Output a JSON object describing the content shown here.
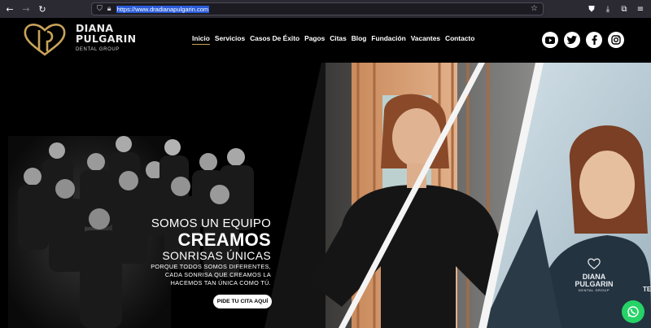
{
  "browser": {
    "url": "https://www.dradianapulgarin.com",
    "icons": [
      "back-arrow-icon",
      "forward-arrow-icon",
      "reload-icon",
      "shield-icon",
      "lock-icon",
      "star-icon",
      "pocket-icon",
      "download-icon",
      "extensions-icon",
      "menu-icon"
    ]
  },
  "brand": {
    "name_line1": "DIANA",
    "name_line2": "PULGARIN",
    "subtitle": "DENTAL GROUP",
    "gold": "#c9a35a"
  },
  "nav": {
    "items": [
      "Inicio",
      "Servicios",
      "Casos De Éxito",
      "Pagos",
      "Citas",
      "Blog",
      "Fundación",
      "Vacantes",
      "Contacto"
    ],
    "active": "Inicio"
  },
  "social": [
    "youtube-icon",
    "twitter-icon",
    "facebook-icon",
    "instagram-icon"
  ],
  "hero": {
    "line1": "SOMOS UN EQUIPO",
    "line2": "CREAMOS",
    "line3": "SONRISAS ÚNICAS",
    "body_line1": "PORQUE TODOS SOMOS DIFERENTES,",
    "body_line2": "CADA SONRISA QUE CREAMOS LA",
    "body_line3": "HACEMOS TAN ÚNICA COMO TÚ.",
    "cta": "PIDE TU CITA AQUÍ",
    "badge_line1": "DIANA",
    "badge_line2": "PULGARIN",
    "badge_line3": "DENTAL GROUP",
    "badge_line4": "TE"
  },
  "whatsapp_color": "#25d366"
}
